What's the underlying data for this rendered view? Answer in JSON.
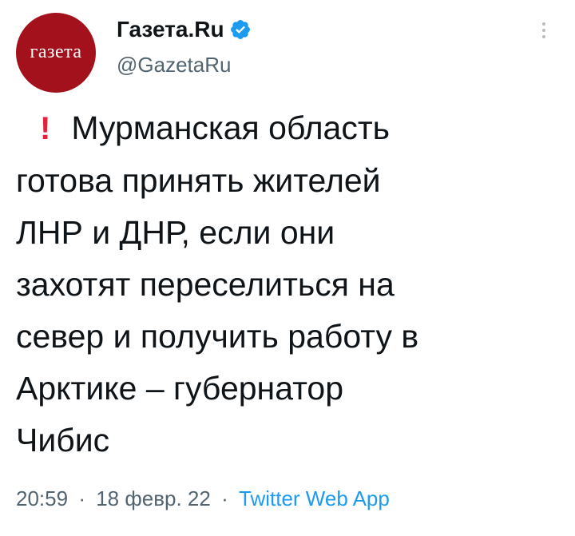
{
  "account": {
    "avatar_text": "газета",
    "display_name": "Газета.Ru",
    "handle": "@GazetaRu",
    "verified_icon": "verified-badge-icon",
    "avatar_color": "#a3121c"
  },
  "tweet": {
    "exclamation": "!",
    "lines": [
      "Мурманская область",
      "готова принять жителей",
      "ЛНР и ДНР, если они",
      "захотят переселиться на",
      "север и получить работу в",
      "Арктике – губернатор",
      "Чибис"
    ]
  },
  "meta": {
    "time": "20:59",
    "separator": "·",
    "date": "18 февр. 22",
    "source": "Twitter Web App"
  },
  "colors": {
    "text": "#0f1419",
    "secondary": "#536471",
    "link": "#1d9bf0",
    "alert": "#e0243a"
  }
}
